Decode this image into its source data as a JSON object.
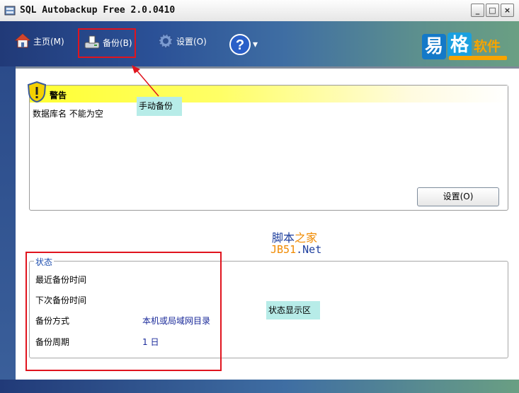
{
  "window": {
    "title": "SQL Autobackup Free 2.0.0410"
  },
  "window_controls": {
    "minimize": "_",
    "maximize": "□",
    "close": "×"
  },
  "toolbar": {
    "items": [
      {
        "label": "主页(M)",
        "icon": "home-icon"
      },
      {
        "label": "备份(B)",
        "icon": "backup-drive-icon"
      },
      {
        "label": "设置(O)",
        "icon": "gear-icon"
      },
      {
        "label": "?",
        "icon": "help-icon",
        "dropdown": "▾"
      }
    ]
  },
  "logo": {
    "char1": "易",
    "char2": "格",
    "text": "软件"
  },
  "warning": {
    "title": "警告",
    "message": "数据库名 不能为空",
    "button": "设置(O)"
  },
  "annotations": {
    "manual_backup": "手动备份",
    "status_area": "状态显示区"
  },
  "watermark": {
    "part1": "脚本",
    "part2": "之家",
    "line2_a": "JB51",
    "line2_b": ".Net"
  },
  "status": {
    "legend": "状态",
    "rows": [
      {
        "label": "最近备份时间",
        "value": ""
      },
      {
        "label": "下次备份时间",
        "value": ""
      },
      {
        "label": "备份方式",
        "value": "本机或局域网目录"
      },
      {
        "label": "备份周期",
        "value": "1 日"
      }
    ]
  },
  "colors": {
    "accent_red": "#e0141e",
    "callout_bg": "#b7ece8",
    "status_link": "#1a2a9a"
  }
}
